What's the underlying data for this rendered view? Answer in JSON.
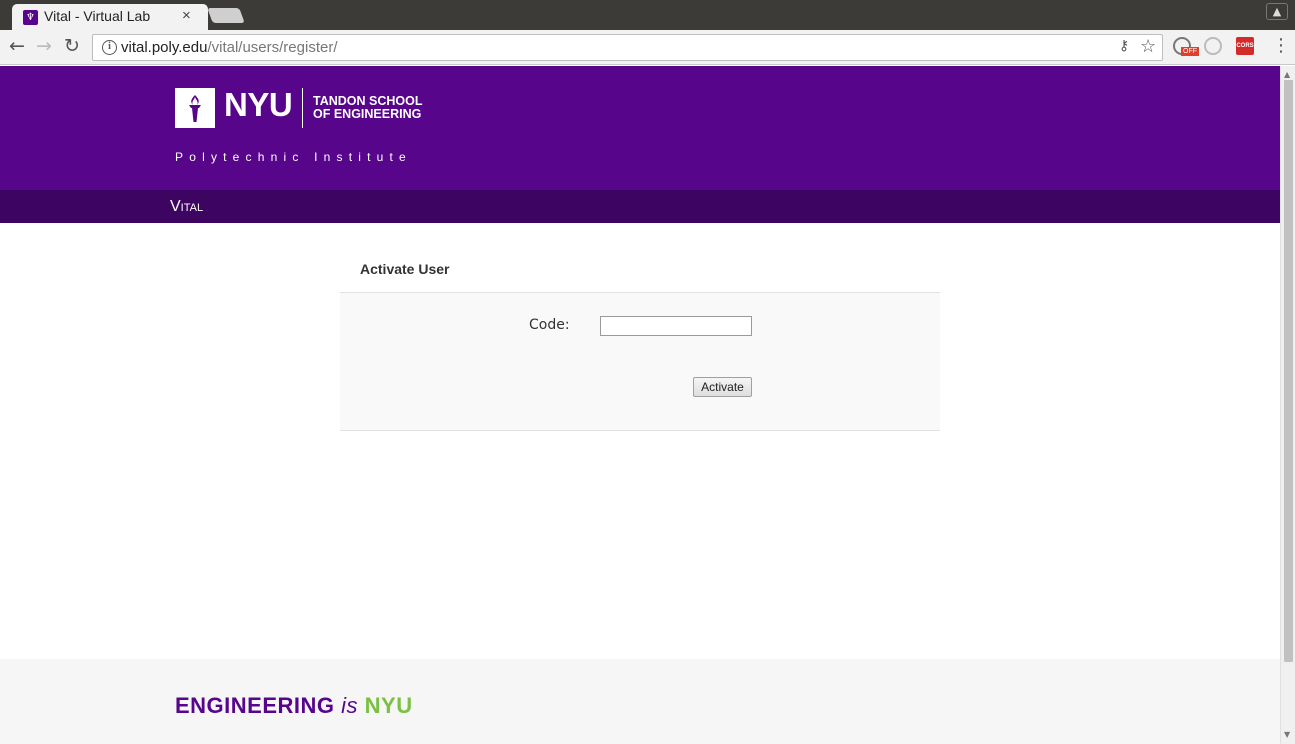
{
  "browser": {
    "tab_title": "Vital - Virtual Lab",
    "tab_close": "×",
    "url_host": "vital.poly.edu",
    "url_path": "/vital/users/register/",
    "extension_badge_off": "OFF",
    "extension_cors_label": "CORS"
  },
  "header": {
    "logo_text": "NYU",
    "school_line1": "TANDON SCHOOL",
    "school_line2": "OF ENGINEERING",
    "institute": "Polytechnic Institute",
    "brand_color": "#57068c",
    "nav_color": "#3d0462"
  },
  "nav": {
    "vital_label": "Vital"
  },
  "activate_form": {
    "title": "Activate User",
    "code_label": "Code:",
    "code_value": "",
    "submit_label": "Activate"
  },
  "footer": {
    "tagline_engineering": "ENGINEERING",
    "tagline_is": "is",
    "tagline_nyu": "NYU",
    "nyu_green": "#7ac143"
  }
}
